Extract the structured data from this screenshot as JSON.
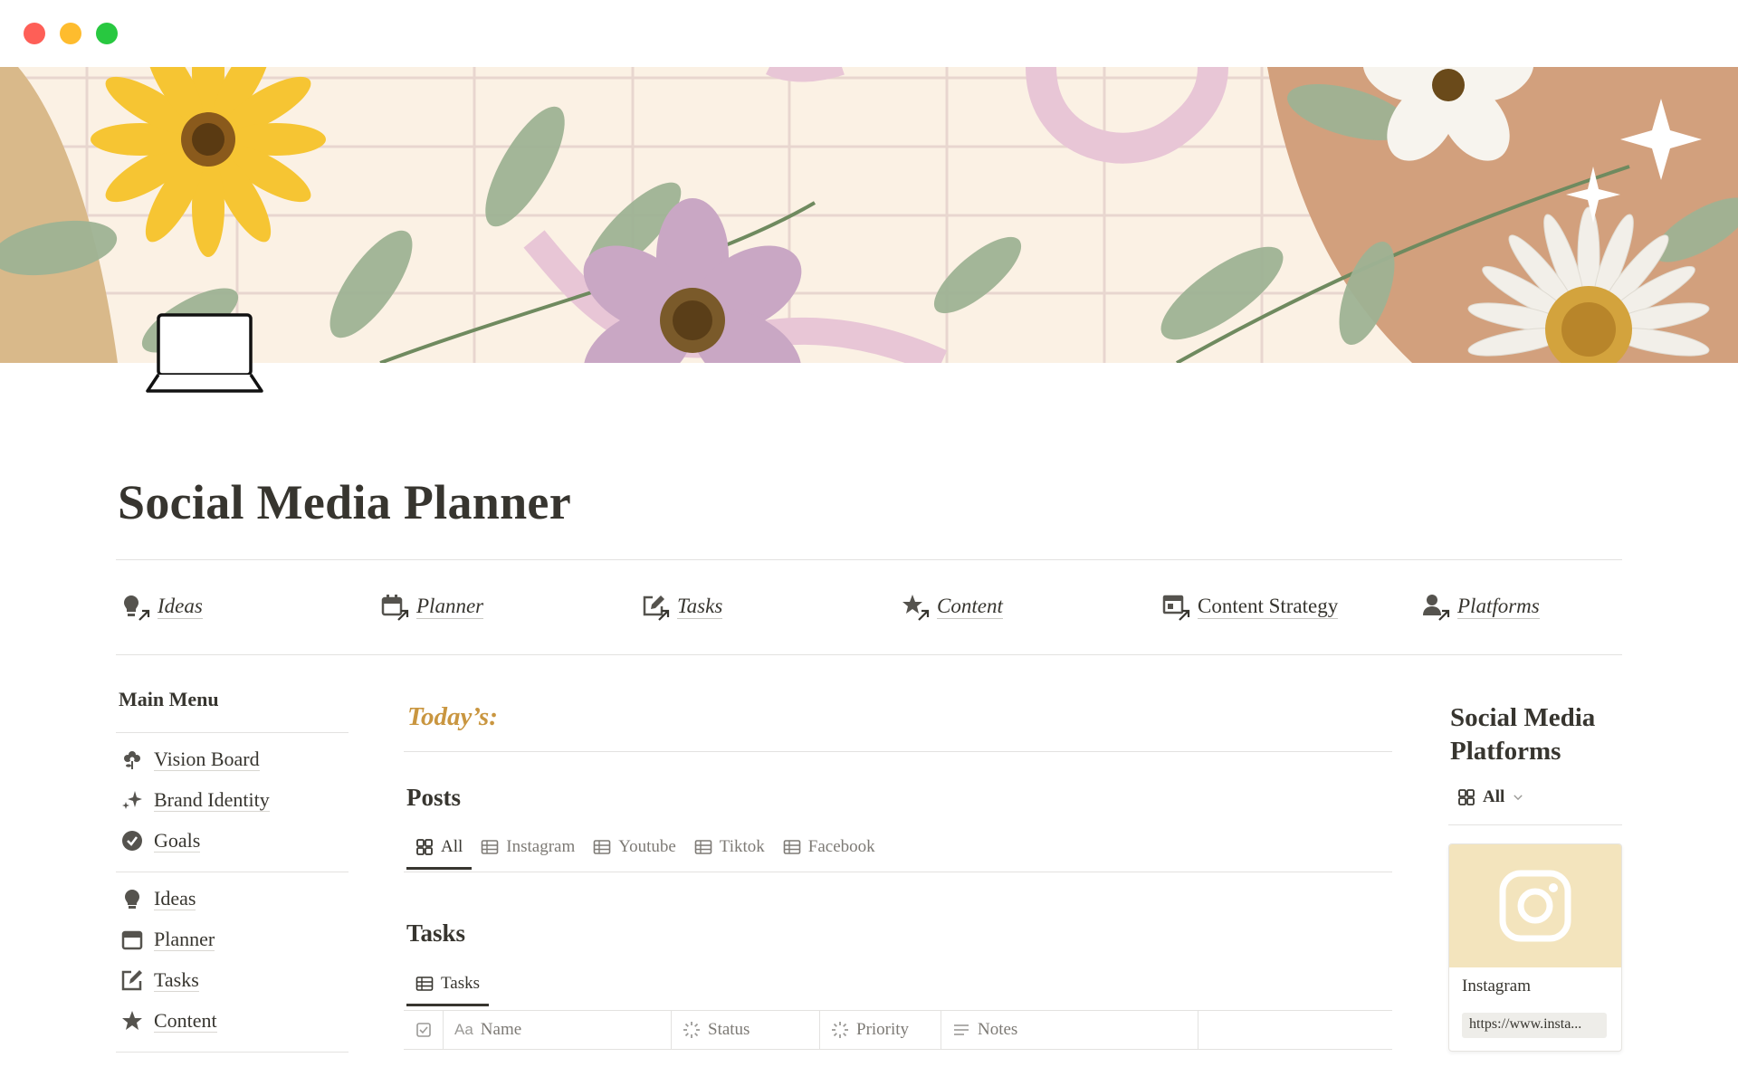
{
  "window": {
    "controls": [
      "close",
      "minimize",
      "maximize"
    ]
  },
  "cover": {
    "description_icon": "floral-cover-image"
  },
  "page": {
    "icon": "laptop-icon",
    "title": "Social Media Planner"
  },
  "topnav": [
    {
      "label": "Ideas",
      "icon": "lightbulb-icon",
      "italic": true
    },
    {
      "label": "Planner",
      "icon": "calendar-icon",
      "italic": true
    },
    {
      "label": "Tasks",
      "icon": "edit-icon",
      "italic": true
    },
    {
      "label": "Content",
      "icon": "star-icon",
      "italic": true
    },
    {
      "label": "Content Strategy",
      "icon": "layout-icon",
      "italic": false
    },
    {
      "label": "Platforms",
      "icon": "user-icon",
      "italic": true
    }
  ],
  "main_menu": {
    "title": "Main Menu",
    "group1": [
      {
        "label": "Vision Board",
        "icon": "flower-icon"
      },
      {
        "label": "Brand Identity",
        "icon": "sparkles-icon"
      },
      {
        "label": "Goals",
        "icon": "check-circle-icon"
      }
    ],
    "group2": [
      {
        "label": "Ideas",
        "icon": "lightbulb-icon"
      },
      {
        "label": "Planner",
        "icon": "calendar-icon"
      },
      {
        "label": "Tasks",
        "icon": "edit-icon"
      },
      {
        "label": "Content",
        "icon": "star-icon"
      }
    ]
  },
  "center": {
    "todays": "Today’s:",
    "posts": {
      "title": "Posts",
      "tabs": [
        "All",
        "Instagram",
        "Youtube",
        "Tiktok",
        "Facebook"
      ],
      "active_tab": "All"
    },
    "tasks": {
      "title": "Tasks",
      "tabs": [
        "Tasks"
      ],
      "columns": [
        "Name",
        "Status",
        "Priority",
        "Notes"
      ],
      "name_prefix": "Aa"
    }
  },
  "right": {
    "title": "Social Media Platforms",
    "view_label": "All",
    "card": {
      "name": "Instagram",
      "url": "https://www.insta...",
      "icon": "instagram-icon"
    }
  },
  "colors": {
    "accent": "#c99640",
    "text": "#37352f",
    "muted": "#7d7a75",
    "card_cover": "#f3e4bd"
  }
}
